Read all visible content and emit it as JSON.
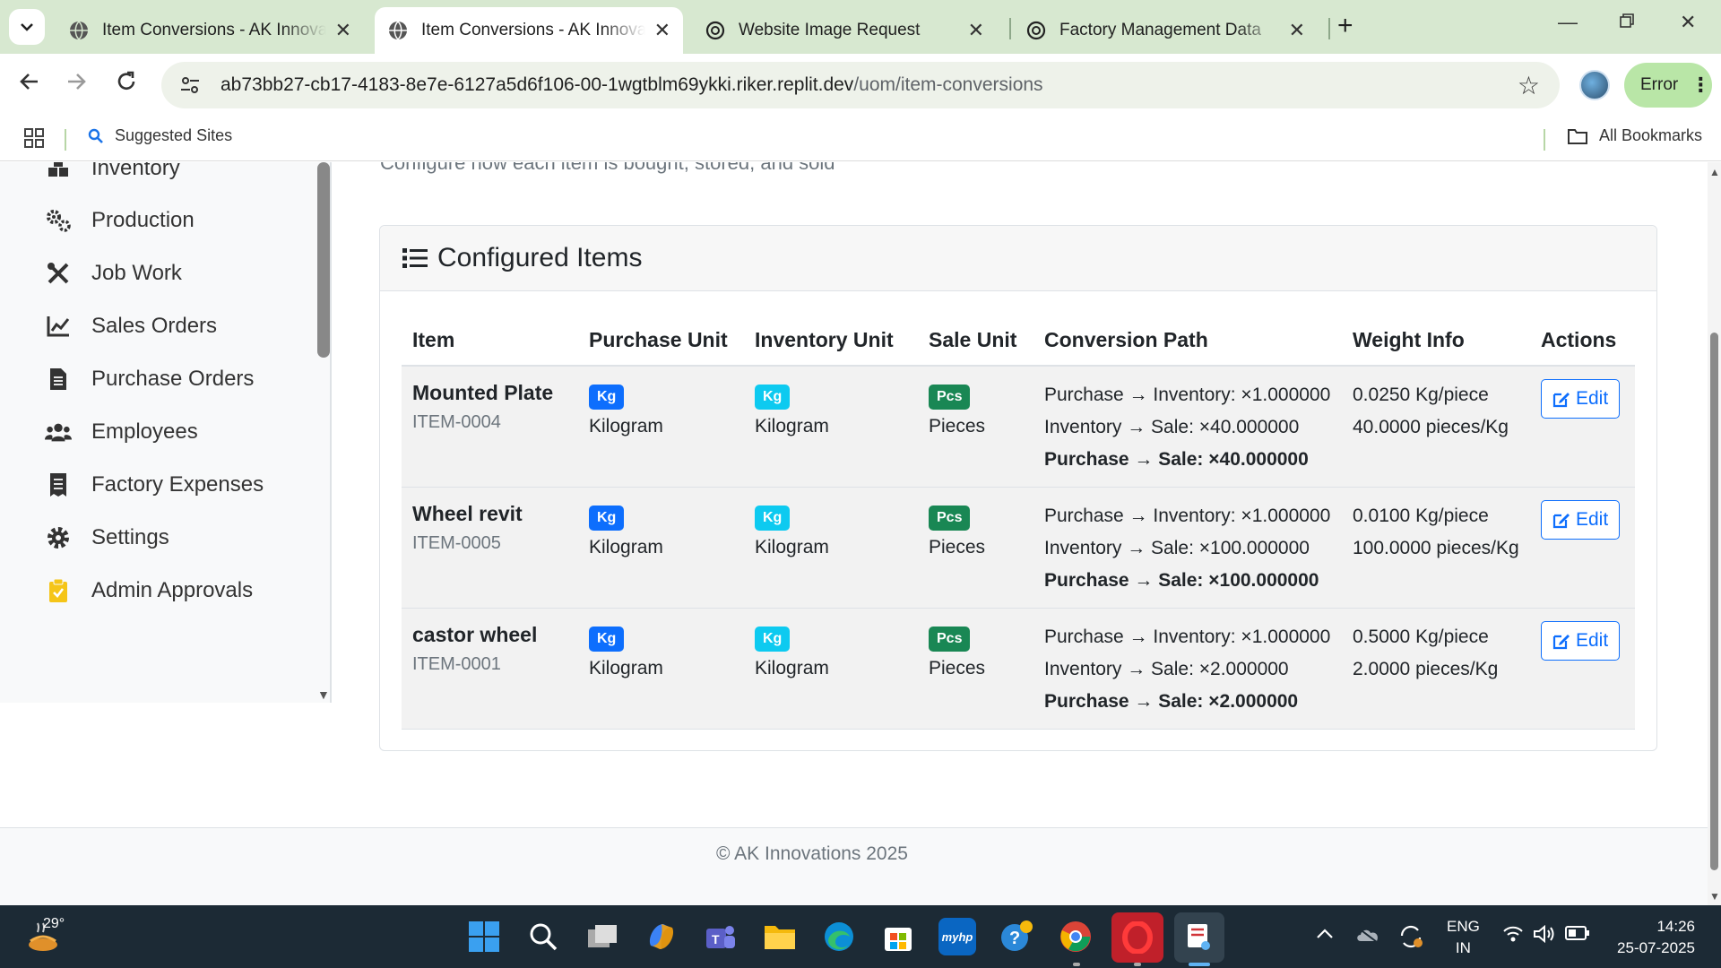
{
  "browser": {
    "tabs": [
      {
        "title": "Item Conversions - AK Innovations",
        "active": false
      },
      {
        "title": "Item Conversions - AK Innovations",
        "active": true
      },
      {
        "title": "Website Image Request",
        "active": false
      },
      {
        "title": "Factory Management Data",
        "active": false
      }
    ],
    "url_host": "ab73bb27-cb17-4183-8e7e-6127a5d6f106-00-1wgtblm69ykki.riker.replit.dev",
    "url_path": "/uom/item-conversions",
    "profile_status": "Error",
    "bookmarks": {
      "suggested": "Suggested Sites",
      "all": "All Bookmarks"
    }
  },
  "sidebar": {
    "items": [
      {
        "label": "Inventory",
        "icon": "boxes-icon"
      },
      {
        "label": "Production",
        "icon": "gears-icon"
      },
      {
        "label": "Job Work",
        "icon": "tools-icon"
      },
      {
        "label": "Sales Orders",
        "icon": "line-chart-icon"
      },
      {
        "label": "Purchase Orders",
        "icon": "file-invoice-icon"
      },
      {
        "label": "Employees",
        "icon": "users-icon"
      },
      {
        "label": "Factory Expenses",
        "icon": "receipt-icon"
      },
      {
        "label": "Settings",
        "icon": "gear-icon"
      },
      {
        "label": "Admin Approvals",
        "icon": "clipboard-check-icon"
      }
    ]
  },
  "page": {
    "subtitle": "Configure how each item is bought, stored, and sold",
    "card_title": "Configured Items",
    "columns": [
      "Item",
      "Purchase Unit",
      "Inventory Unit",
      "Sale Unit",
      "Conversion Path",
      "Weight Info",
      "Actions"
    ],
    "rows": [
      {
        "name": "Mounted Plate",
        "code": "ITEM-0004",
        "purchase_badge": "Kg",
        "purchase_unit": "Kilogram",
        "inventory_badge": "Kg",
        "inventory_unit": "Kilogram",
        "sale_badge": "Pcs",
        "sale_unit": "Pieces",
        "conv1": "Purchase → Inventory: ×1.000000",
        "conv2": "Inventory → Sale: ×40.000000",
        "conv3": "Purchase → Sale: ×40.000000",
        "weight1": "0.0250 Kg/piece",
        "weight2": "40.0000 pieces/Kg",
        "action": "Edit"
      },
      {
        "name": "Wheel revit",
        "code": "ITEM-0005",
        "purchase_badge": "Kg",
        "purchase_unit": "Kilogram",
        "inventory_badge": "Kg",
        "inventory_unit": "Kilogram",
        "sale_badge": "Pcs",
        "sale_unit": "Pieces",
        "conv1": "Purchase → Inventory: ×1.000000",
        "conv2": "Inventory → Sale: ×100.000000",
        "conv3": "Purchase → Sale: ×100.000000",
        "weight1": "0.0100 Kg/piece",
        "weight2": "100.0000 pieces/Kg",
        "action": "Edit"
      },
      {
        "name": "castor wheel",
        "code": "ITEM-0001",
        "purchase_badge": "Kg",
        "purchase_unit": "Kilogram",
        "inventory_badge": "Kg",
        "inventory_unit": "Kilogram",
        "sale_badge": "Pcs",
        "sale_unit": "Pieces",
        "conv1": "Purchase → Inventory: ×1.000000",
        "conv2": "Inventory → Sale: ×2.000000",
        "conv3": "Purchase → Sale: ×2.000000",
        "weight1": "0.5000 Kg/piece",
        "weight2": "2.0000 pieces/Kg",
        "action": "Edit"
      }
    ],
    "footer": "© AK Innovations 2025"
  },
  "taskbar": {
    "temperature": "29°",
    "lang_line1": "ENG",
    "lang_line2": "IN",
    "time": "14:26",
    "date": "25-07-2025",
    "hp_label": "myhp"
  },
  "colors": {
    "tabbar": "#d7e8d0",
    "badge_kg_purchase": "#0d6efd",
    "badge_kg_inventory": "#0dcaf0",
    "badge_pcs": "#198754",
    "edit_button": "#0d6efd",
    "taskbar": "#1c2a35"
  }
}
